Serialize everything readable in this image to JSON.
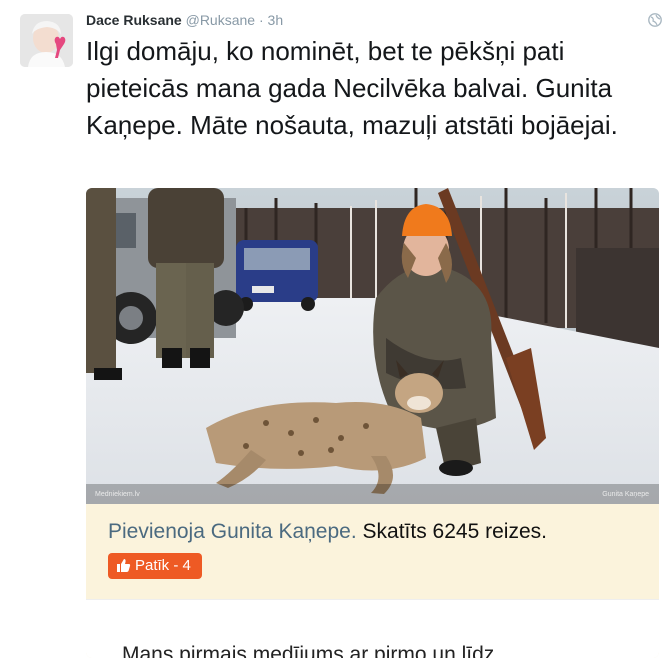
{
  "tweet": {
    "author_name": "Dace Ruksane",
    "author_handle": "@Ruksane",
    "separator": "·",
    "time": "3h",
    "text": "Ilgi domāju, ko nominēt, bet te pēkšņi pati pieteicās mana gada Necilvēka balvai. Gunita Kaņepe. Māte nošauta, mazuļi atstāti bojāejai."
  },
  "media": {
    "watermark_left": "Medniekiem.lv",
    "watermark_right": "Gunita Kaņepe",
    "card": {
      "added_by": "Pievienoja Gunita Kaņepe.",
      "views": "Skatīts 6245 reizes.",
      "like_label": "Patīk - 4",
      "post_text": "Mans pirmais medījums ar pirmo un līdz"
    }
  },
  "colors": {
    "accent_orange": "#ee5a24",
    "card_background": "#fbf3dc",
    "author_link": "#4b6a80"
  }
}
